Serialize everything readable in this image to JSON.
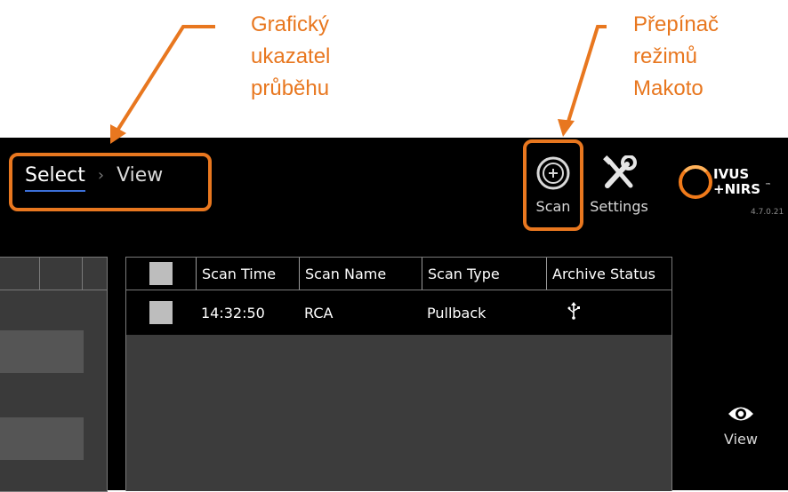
{
  "annotations": {
    "progress_indicator_lines": [
      "Grafický",
      "ukazatel",
      "průběhu"
    ],
    "mode_switch_lines": [
      "Přepínač",
      "režimů",
      "Makoto"
    ]
  },
  "breadcrumb": {
    "step1": "Select",
    "separator": "›",
    "step2": "View"
  },
  "toolbar": {
    "scan_label": "Scan",
    "settings_label": "Settings"
  },
  "logo": {
    "line1": "IVUS",
    "line2": "+NIRS",
    "tm": "™",
    "version": "4.7.0.21"
  },
  "scan_table": {
    "headers": [
      "Scan Time",
      "Scan Name",
      "Scan Type",
      "Archive Status"
    ],
    "rows": [
      {
        "time": "14:32:50",
        "name": "RCA",
        "type": "Pullback",
        "archive_icon": "usb-icon"
      }
    ]
  },
  "side_actions": {
    "view_label": "View"
  },
  "colors": {
    "accent": "#e8771f",
    "select_underline": "#3b6fd8",
    "background": "#000000"
  }
}
